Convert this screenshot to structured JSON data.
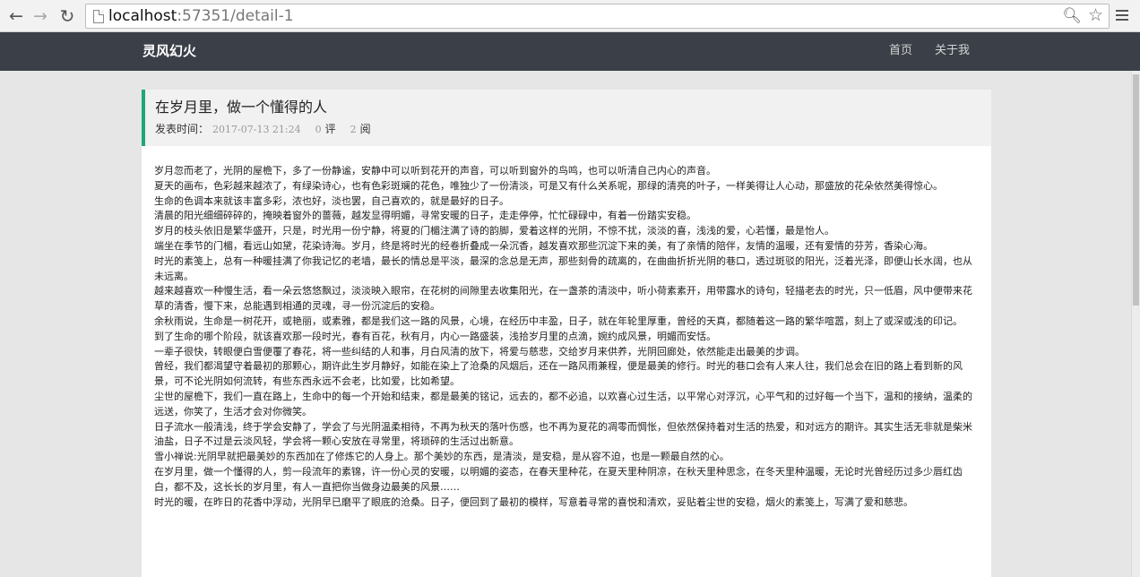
{
  "browser": {
    "url_host": "localhost",
    "url_rest": ":57351/detail-1"
  },
  "site": {
    "brand": "灵风幻火",
    "nav": {
      "home": "首页",
      "about": "关于我"
    }
  },
  "article": {
    "title": "在岁月里，做一个懂得的人",
    "meta": {
      "published_label": "发表时间：",
      "date": "2017-07-13 21:24",
      "comments_count": "0",
      "comments_label": "评",
      "views_count": "2",
      "views_label": "阅"
    },
    "paragraphs": [
      "岁月忽而老了，光阴的屋檐下，多了一份静谧，安静中可以听到花开的声音，可以听到窗外的鸟鸣，也可以听清自己内心的声音。",
      "夏天的画布，色彩越来越浓了，有绿染诗心，也有色彩斑斓的花色，唯独少了一份清淡，可是又有什么关系呢，那绿的清亮的叶子，一样美得让人心动，那盛放的花朵依然美得惊心。",
      "生命的色调本来就该丰富多彩，浓也好，淡也罢，自己喜欢的，就是最好的日子。",
      "清晨的阳光细细碎碎的，掩映着窗外的蔷薇，越发显得明媚，寻常安暖的日子，走走停停，忙忙碌碌中，有着一份踏实安稳。",
      "岁月的枝头依旧是繁华盛开，只是，时光用一份宁静，将夏的门楣注满了诗的韵脚，爱着这样的光阴，不惊不扰，淡淡的喜，浅浅的爱，心若懂，最是怡人。",
      "端坐在季节的门楣，看远山如黛，花染诗海。岁月，终是将时光的经卷折叠成一朵沉香，越发喜欢那些沉淀下来的美，有了亲情的陪伴，友情的温暖，还有爱情的芬芳，香染心海。",
      "时光的素笺上，总有一种暖挂满了你我记忆的老墙，最长的情总是平淡，最深的念总是无声，那些刻骨的疏离的，在曲曲折折光阴的巷口，透过斑驳的阳光，泛着光泽，即便山长水阔，也从未远离。",
      "越来越喜欢一种慢生活，看一朵云悠悠飘过，淡淡映入眼帘，在花树的间隙里去收集阳光，在一盏茶的清淡中，听小荷素素开，用带露水的诗句，轻描老去的时光，只一低眉，风中便带来花草的清香，慢下来，总能遇到相通的灵魂，寻一份沉淀后的安稳。",
      "余秋雨说，生命是一树花开，或艳丽，或素雅，都是我们这一路的风景，心境，在经历中丰盈，日子，就在年轮里厚重，曾经的天真，都随着这一路的繁华喧嚣，刻上了或深或浅的印记。",
      "到了生命的哪个阶段，就该喜欢那一段时光，春有百花，秋有月，内心一路盛装，浅拾岁月里的点滴，婉约成风景，明媚而安恬。",
      "一辈子很快，转眼便白雪便覆了春花，将一些纠结的人和事，月白风清的放下，将爱与慈悲，交给岁月来供养，光阴回廊处，依然能走出最美的步调。",
      "曾经，我们都渴望守着最初的那颗心，期许此生岁月静好，如能在染上了沧桑的风烟后，还在一路风雨兼程，便是最美的修行。时光的巷口会有人来人往，我们总会在旧的路上看到新的风景，可不论光阴如何流转，有些东西永远不会老，比如爱，比如希望。",
      "尘世的屋檐下，我们一直在路上，生命中的每一个开始和结束，都是最美的铭记，远去的，都不必追，以欢喜心过生活，以平常心对浮沉，心平气和的过好每一个当下，温和的接纳，温柔的远送，你笑了，生活才会对你微笑。",
      "日子流水一般清浅，终于学会安静了，学会了与光阴温柔相待，不再为秋天的落叶伤感，也不再为夏花的凋零而惆怅，但依然保持着对生活的热爱，和对远方的期许。其实生活无非就是柴米油盐，日子不过是云淡风轻，学会将一颗心安放在寻常里，将琐碎的生活过出新意。",
      "雪小禅说:光阴早就把最美妙的东西加在了修炼它的人身上。那个美妙的东西，是清淡，是安稳，是从容不迫，也是一颗最自然的心。",
      "在岁月里，做一个懂得的人，剪一段流年的素锦，许一份心灵的安暖，以明媚的姿态，在春天里种花，在夏天里种阴凉，在秋天里种思念，在冬天里种温暖，无论时光曾经历过多少唇红齿白，都不及，这长长的岁月里，有人一直把你当做身边最美的风景……",
      "时光的暖，在昨日的花香中浮动，光阴早已磨平了眼底的沧桑。日子，便回到了最初的模样，写意着寻常的喜悦和清欢，妥贴着尘世的安稳，烟火的素笺上，写满了爱和慈悲。"
    ]
  }
}
